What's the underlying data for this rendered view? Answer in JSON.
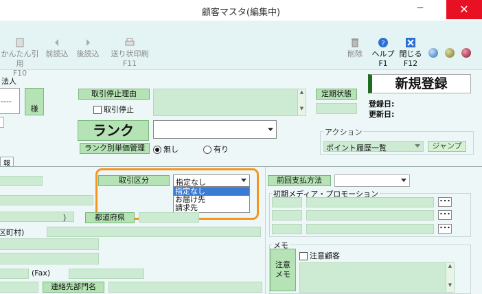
{
  "window": {
    "title": "顧客マスタ(編集中)",
    "minimize": "─",
    "close": "✕"
  },
  "toolbar": {
    "kantan": {
      "label": "かんたん引用",
      "key": "F10"
    },
    "prev": {
      "label": "前読込"
    },
    "next": {
      "label": "後読込"
    },
    "print": {
      "label": "送り状印刷",
      "key": "F11"
    },
    "delete": {
      "label": "削除"
    },
    "help": {
      "label": "ヘルプ",
      "key": "F1"
    },
    "close": {
      "label": "閉じる",
      "key": "F12"
    }
  },
  "form": {
    "corp_label": "法人",
    "dashes": "----",
    "sama": "様",
    "stop_reason_label": "取引停止理由",
    "stop_checkbox": "取引停止",
    "rank_label": "ランク",
    "rank_price_label": "ランク別単価管理",
    "radio_none": "無し",
    "radio_yes": "有り",
    "teiki_label": "定期状態",
    "status_badge": "新規登録",
    "registered_label": "登録日:",
    "updated_label": "更新日:",
    "action_title": "アクション",
    "action_value": "ポイント履歴一覧",
    "jump_button": "ジャンプ",
    "tab_partial": "報",
    "torihiki_label": "取引区分",
    "torihiki_value": "指定なし",
    "dropdown_options": [
      "指定なし",
      "お届け先",
      "請求先"
    ],
    "paren_close": "）",
    "prefecture_label": "都道府県",
    "city_label": "区町村)",
    "fax_label": "(Fax)",
    "contact_dept_label": "連絡先部門名",
    "payment_label": "前回支払方法",
    "media_title": "初期メディア・プロモーション",
    "dots": "･･･",
    "memo_title": "メモ",
    "caution_customer": "注意顧客",
    "caution_memo": "注意\nメモ"
  },
  "colors": {
    "label_bg": "#b5e3b5",
    "field_bg": "#cdebd2",
    "highlight": "#f7941d",
    "status_green": "#1f6b1f",
    "select_blue": "#3a7bd5"
  }
}
